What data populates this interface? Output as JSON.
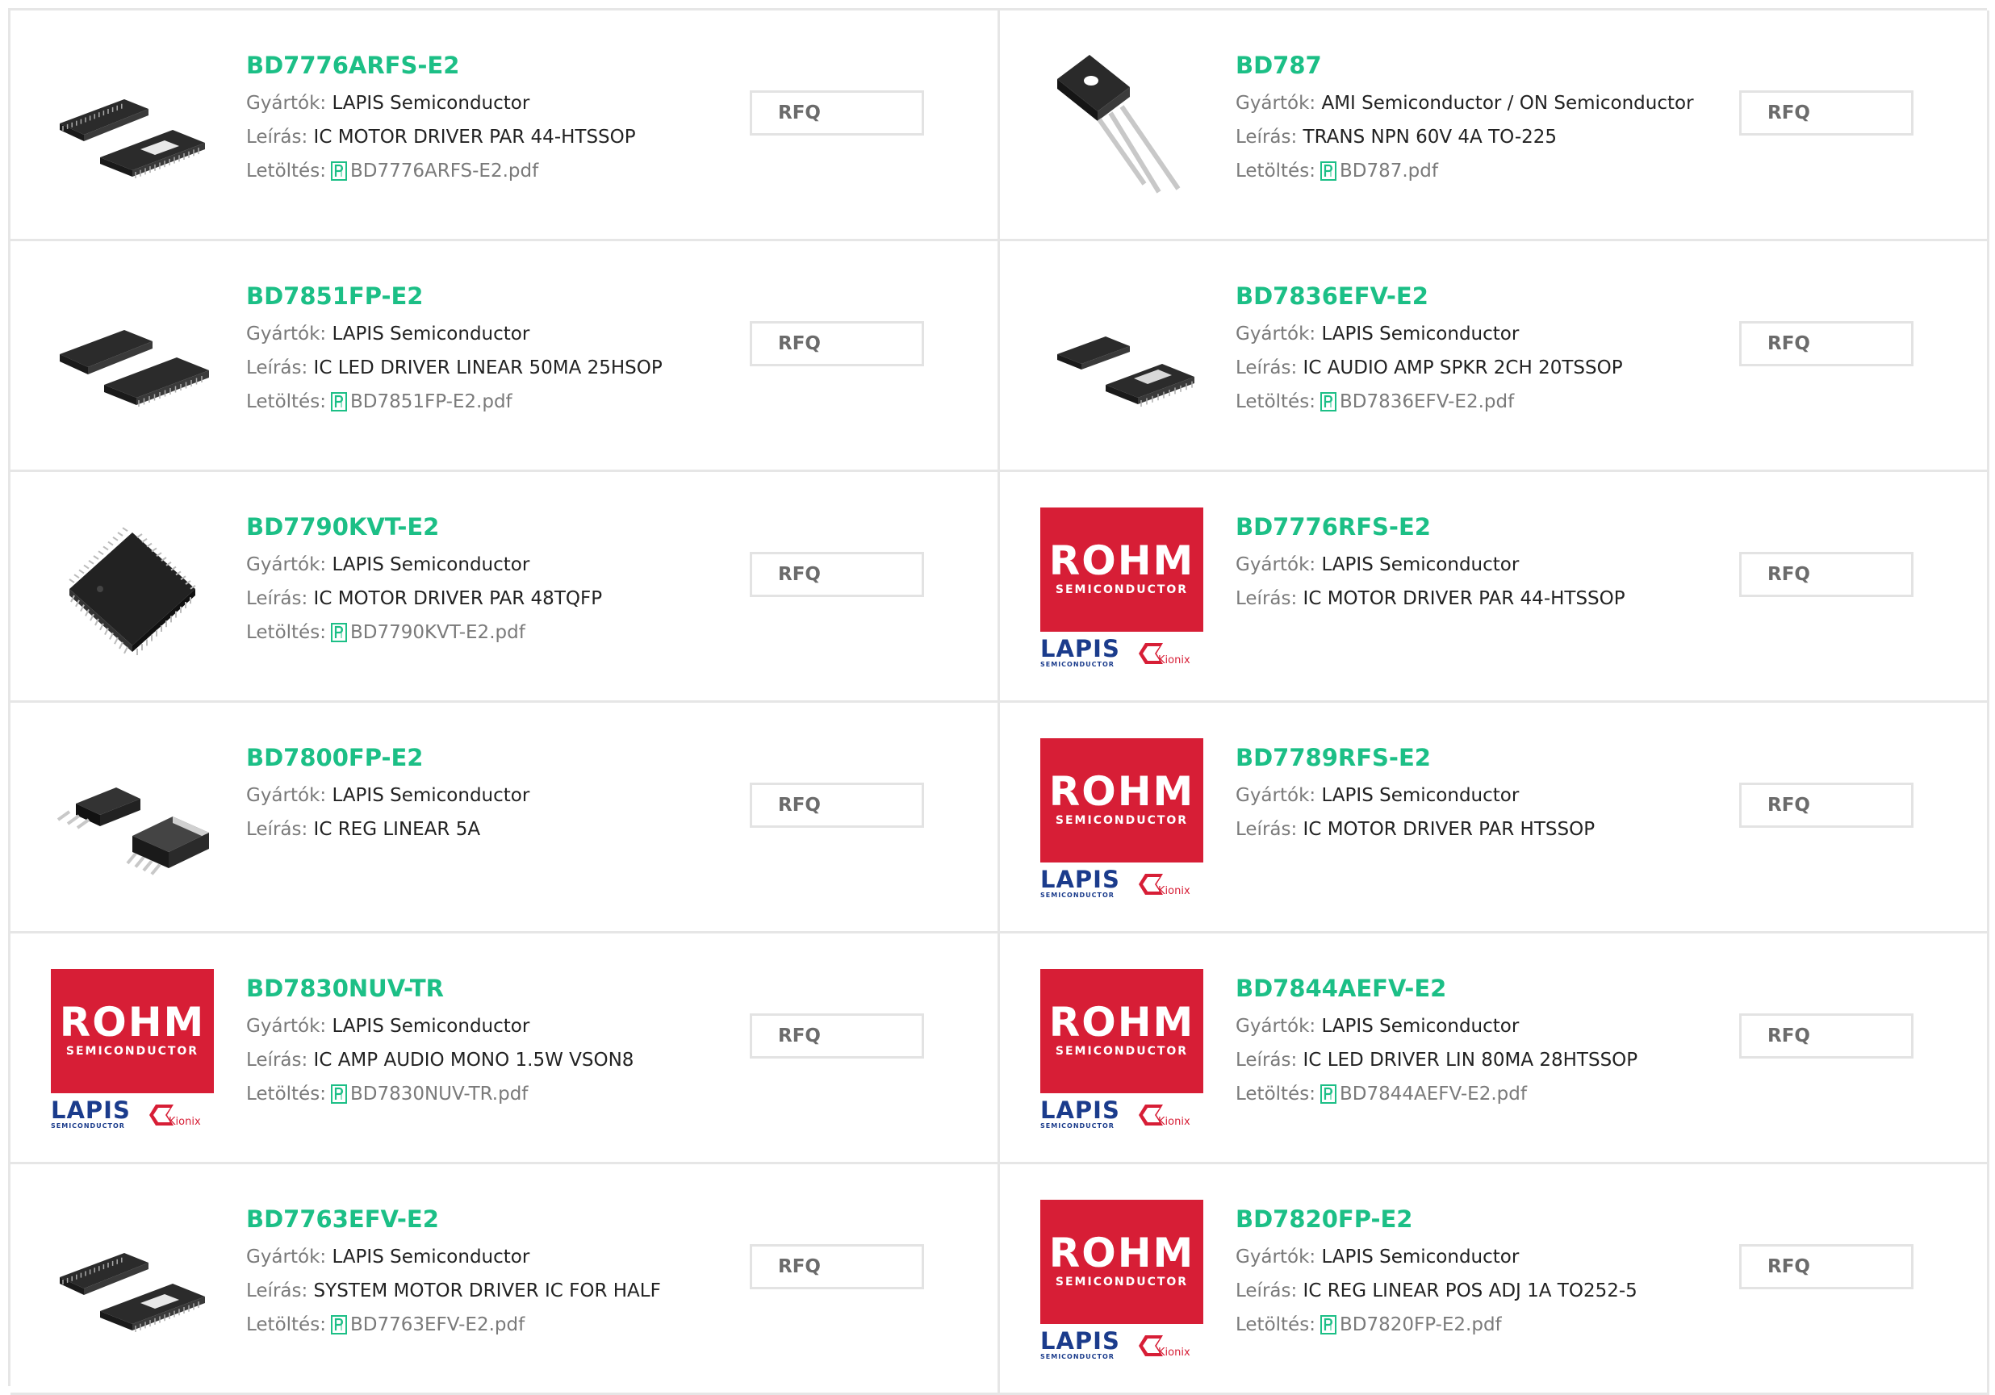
{
  "labels": {
    "manufacturer": "Gyártók:",
    "description": "Leírás:",
    "download": "Letöltés:",
    "rfq": "RFQ"
  },
  "logo_text": {
    "rohm": "ROHM",
    "semiconductor": "SEMICONDUCTOR",
    "lapis": "LAPIS",
    "lapis_sub": "SEMICONDUCTOR",
    "kionix": "Kionix"
  },
  "colors": {
    "part_number": "#1cbf86",
    "rohm_red": "#d71e36",
    "lapis_blue": "#1b3c8c",
    "border": "#e6e6e6"
  },
  "products": [
    {
      "part": "BD7776ARFS-E2",
      "manufacturer": "LAPIS Semiconductor",
      "description": "IC MOTOR DRIVER PAR 44-HTSSOP",
      "pdf": "BD7776ARFS-E2.pdf",
      "image": "htssop-package"
    },
    {
      "part": "BD787",
      "manufacturer": "AMI Semiconductor / ON Semiconductor",
      "description": "TRANS NPN 60V 4A TO-225",
      "pdf": "BD787.pdf",
      "image": "to225-transistor"
    },
    {
      "part": "BD7851FP-E2",
      "manufacturer": "LAPIS Semiconductor",
      "description": "IC LED DRIVER LINEAR 50MA 25HSOP",
      "pdf": "BD7851FP-E2.pdf",
      "image": "hsop-package"
    },
    {
      "part": "BD7836EFV-E2",
      "manufacturer": "LAPIS Semiconductor",
      "description": "IC AUDIO AMP SPKR 2CH 20TSSOP",
      "pdf": "BD7836EFV-E2.pdf",
      "image": "tssop-package"
    },
    {
      "part": "BD7790KVT-E2",
      "manufacturer": "LAPIS Semiconductor",
      "description": "IC MOTOR DRIVER PAR 48TQFP",
      "pdf": "BD7790KVT-E2.pdf",
      "image": "tqfp-package"
    },
    {
      "part": "BD7776RFS-E2",
      "manufacturer": "LAPIS Semiconductor",
      "description": "IC MOTOR DRIVER PAR 44-HTSSOP",
      "pdf": "",
      "image": "rohm-logo"
    },
    {
      "part": "BD7800FP-E2",
      "manufacturer": "LAPIS Semiconductor",
      "description": "IC REG LINEAR 5A",
      "pdf": "",
      "image": "to252-package"
    },
    {
      "part": "BD7789RFS-E2",
      "manufacturer": "LAPIS Semiconductor",
      "description": "IC MOTOR DRIVER PAR HTSSOP",
      "pdf": "",
      "image": "rohm-logo"
    },
    {
      "part": "BD7830NUV-TR",
      "manufacturer": "LAPIS Semiconductor",
      "description": "IC AMP AUDIO MONO 1.5W VSON8",
      "pdf": "BD7830NUV-TR.pdf",
      "image": "rohm-logo"
    },
    {
      "part": "BD7844AEFV-E2",
      "manufacturer": "LAPIS Semiconductor",
      "description": "IC LED DRIVER LIN 80MA 28HTSSOP",
      "pdf": "BD7844AEFV-E2.pdf",
      "image": "rohm-logo"
    },
    {
      "part": "BD7763EFV-E2",
      "manufacturer": "LAPIS Semiconductor",
      "description": "SYSTEM MOTOR DRIVER IC FOR HALF",
      "pdf": "BD7763EFV-E2.pdf",
      "image": "htssop-package"
    },
    {
      "part": "BD7820FP-E2",
      "manufacturer": "LAPIS Semiconductor",
      "description": "IC REG LINEAR POS ADJ 1A TO252-5",
      "pdf": "BD7820FP-E2.pdf",
      "image": "rohm-logo"
    }
  ]
}
